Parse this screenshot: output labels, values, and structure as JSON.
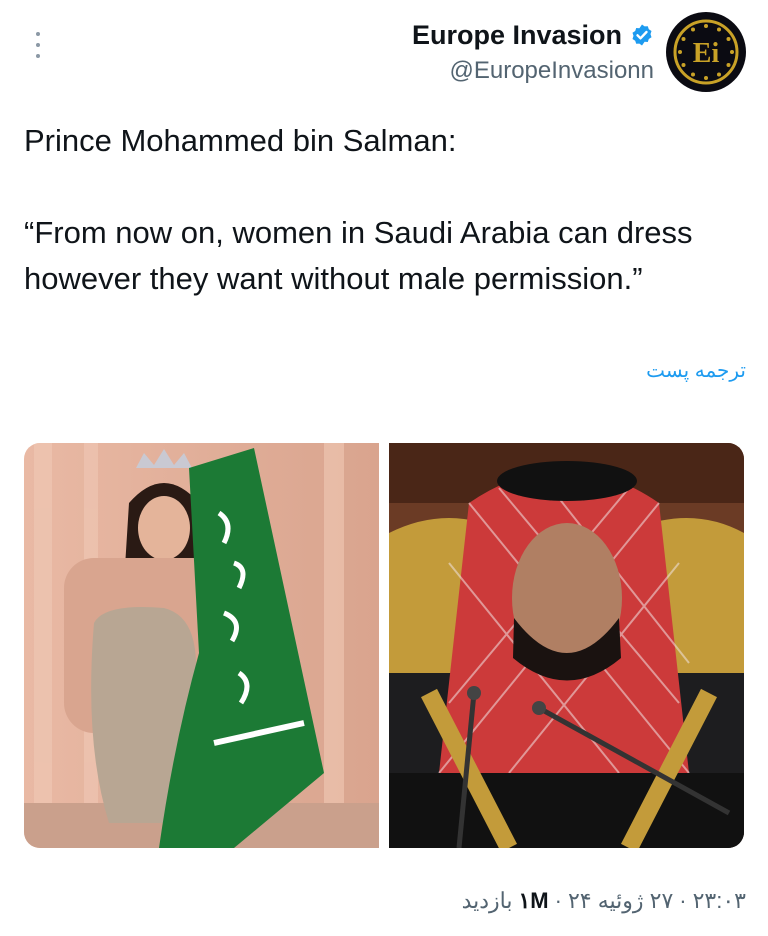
{
  "author": {
    "display_name": "Europe Invasion",
    "handle": "@EuropeInvasionn",
    "verified": true,
    "avatar_text": "Ei",
    "avatar_icon": "Ei-logo"
  },
  "tweet": {
    "text": "Prince Mohammed bin Salman:\n\n“From now on, women in Saudi Arabia can dress however they want without male permission.”",
    "translate_label": "ترجمه پست"
  },
  "media": [
    {
      "icon": "photo-woman-with-saudi-flag"
    },
    {
      "icon": "photo-man-at-microphone"
    }
  ],
  "meta": {
    "time": "۲۳:۰۳",
    "sep1": "·",
    "date": "۲۷ ژوئیه ۲۴",
    "sep2": "·",
    "views_count": "۱M",
    "views_label": "بازدید"
  },
  "colors": {
    "link": "#1d9bf0",
    "verified": "#1d9bf0",
    "secondary_text": "#536471",
    "flag_green": "#1c7a35",
    "avatar_gold": "#c9a227"
  }
}
